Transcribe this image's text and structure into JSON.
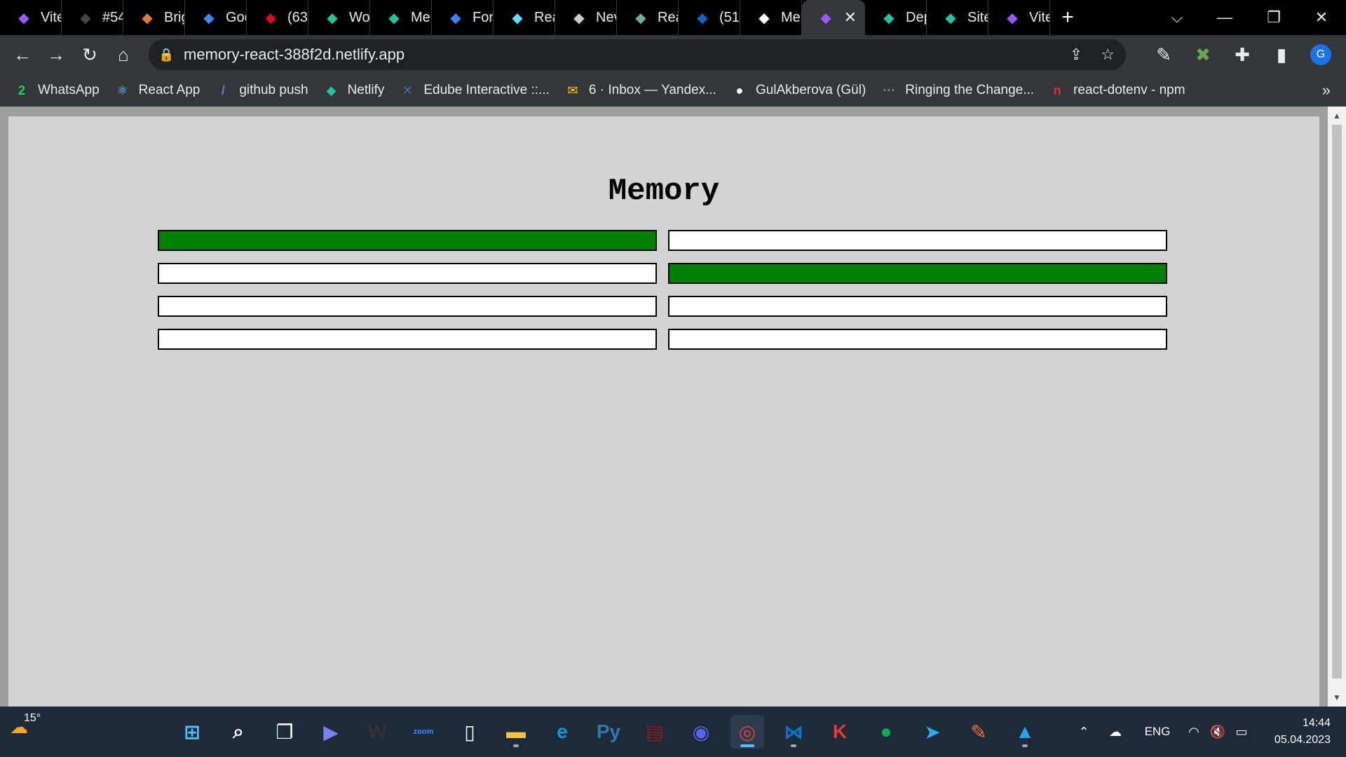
{
  "tabs": [
    {
      "label": "Vite",
      "icon": "vite-icon",
      "color": "#9c59ff"
    },
    {
      "label": "#54",
      "icon": "github-icon",
      "color": "#444444"
    },
    {
      "label": "Brig",
      "icon": "brig-icon",
      "color": "#e37933"
    },
    {
      "label": "Goo",
      "icon": "google-translate-icon",
      "color": "#4285f4"
    },
    {
      "label": "(63",
      "icon": "pinterest-icon",
      "color": "#e60023"
    },
    {
      "label": "Wo",
      "icon": "netlify-icon",
      "color": "#25c2a0"
    },
    {
      "label": "Me",
      "icon": "netlify-icon",
      "color": "#25c2a0"
    },
    {
      "label": "Fon",
      "icon": "flag-icon",
      "color": "#3b82f6"
    },
    {
      "label": "Rea",
      "icon": "react-icon",
      "color": "#61dafb"
    },
    {
      "label": "Nev",
      "icon": "chrome-icon",
      "color": "#cccccc"
    },
    {
      "label": "Rea",
      "icon": "openai-icon",
      "color": "#74aa9c"
    },
    {
      "label": "(51)",
      "icon": "linkedin-icon",
      "color": "#0a66c2"
    },
    {
      "label": "Me",
      "icon": "github-icon",
      "color": "#ffffff"
    },
    {
      "label": "",
      "icon": "vite-icon",
      "color": "#9c59ff",
      "active": true,
      "close": "✕"
    },
    {
      "label": "Dep",
      "icon": "netlify-icon",
      "color": "#25c2a0"
    },
    {
      "label": "Site",
      "icon": "netlify-icon",
      "color": "#25c2a0"
    },
    {
      "label": "Vite",
      "icon": "vite-icon",
      "color": "#9c59ff"
    }
  ],
  "newtab_label": "+",
  "address": {
    "url": "memory-react-388f2d.netlify.app"
  },
  "profile_initial": "G",
  "bookmarks": [
    {
      "label": "WhatsApp",
      "icon": "whatsapp-icon",
      "color": "#25d366",
      "glyph": "2"
    },
    {
      "label": "React App",
      "icon": "react-icon",
      "color": "#61dafb",
      "glyph": "⚛"
    },
    {
      "label": "github push",
      "icon": "wand-icon",
      "color": "#5c7cfa",
      "glyph": "/"
    },
    {
      "label": "Netlify",
      "icon": "netlify-icon",
      "color": "#25c2a0",
      "glyph": "◆"
    },
    {
      "label": "Edube Interactive ::...",
      "icon": "edube-icon",
      "color": "#4a6fa5",
      "glyph": "✕"
    },
    {
      "label": "6 · Inbox — Yandex...",
      "icon": "mail-icon",
      "color": "#ffcc00",
      "glyph": "✉"
    },
    {
      "label": "GulAkberova (Gül)",
      "icon": "github-icon",
      "color": "#ffffff",
      "glyph": "●"
    },
    {
      "label": "Ringing the Change...",
      "icon": "dots-icon",
      "color": "#888888",
      "glyph": "···"
    },
    {
      "label": "react-dotenv - npm",
      "icon": "npm-icon",
      "color": "#cb3837",
      "glyph": "n"
    }
  ],
  "bookmarks_more": "»",
  "game": {
    "title": "Memory",
    "match_color": "#008000",
    "cards": [
      {
        "row": 0,
        "col": 0,
        "matched": true
      },
      {
        "row": 0,
        "col": 1,
        "matched": false
      },
      {
        "row": 1,
        "col": 0,
        "matched": false
      },
      {
        "row": 1,
        "col": 1,
        "matched": true
      },
      {
        "row": 2,
        "col": 0,
        "matched": false
      },
      {
        "row": 2,
        "col": 1,
        "matched": false
      },
      {
        "row": 3,
        "col": 0,
        "matched": false
      },
      {
        "row": 3,
        "col": 1,
        "matched": false
      }
    ]
  },
  "taskbar": {
    "weather": "15°",
    "apps": [
      {
        "name": "start-icon",
        "color": "#4cc2ff",
        "glyph": "⊞"
      },
      {
        "name": "search-icon",
        "color": "#ffffff",
        "glyph": "⌕"
      },
      {
        "name": "task-view-icon",
        "color": "#ffffff",
        "glyph": "❐"
      },
      {
        "name": "teams-icon",
        "color": "#7b83eb",
        "glyph": "▶"
      },
      {
        "name": "website-copier-icon",
        "color": "#333333",
        "glyph": "W"
      },
      {
        "name": "zoom-icon",
        "color": "#2d8cff",
        "glyph": "zoom"
      },
      {
        "name": "notepad-icon",
        "color": "#ffffff",
        "glyph": "▯"
      },
      {
        "name": "file-explorer-icon",
        "color": "#f8c23a",
        "glyph": "▬"
      },
      {
        "name": "edge-icon",
        "color": "#0c9ad6",
        "glyph": "e"
      },
      {
        "name": "python-icon",
        "color": "#3776ab",
        "glyph": "Py"
      },
      {
        "name": "winrar-icon",
        "color": "#8b1a1a",
        "glyph": "▤"
      },
      {
        "name": "discord-icon",
        "color": "#5865f2",
        "glyph": "◉"
      },
      {
        "name": "chrome-icon",
        "color": "#db4437",
        "glyph": "◎"
      },
      {
        "name": "vscode-icon",
        "color": "#0078d4",
        "glyph": "⋈"
      },
      {
        "name": "kaspersky-icon",
        "color": "#e53935",
        "glyph": "K"
      },
      {
        "name": "mongodb-icon",
        "color": "#13aa52",
        "glyph": "●"
      },
      {
        "name": "telegram-icon",
        "color": "#2aabee",
        "glyph": "➤"
      },
      {
        "name": "postman-icon",
        "color": "#ff6c37",
        "glyph": "✎"
      },
      {
        "name": "paint-icon",
        "color": "#29a3f0",
        "glyph": "▲"
      }
    ],
    "lang": "ENG",
    "time": "14:44",
    "date": "05.04.2023"
  }
}
